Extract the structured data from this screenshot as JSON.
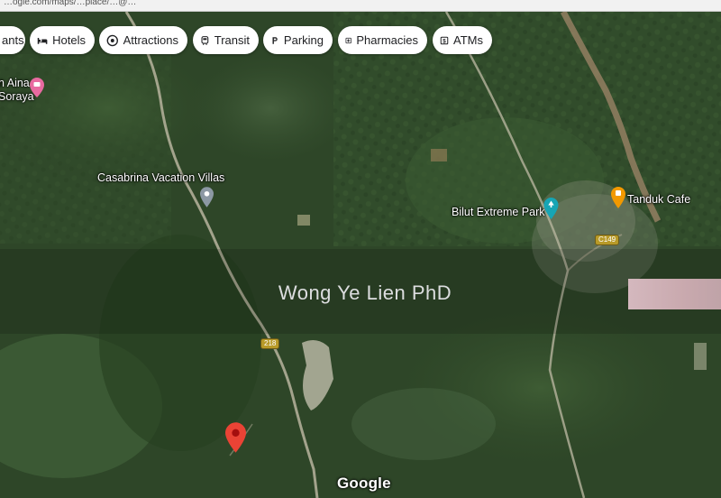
{
  "browser": {
    "url_fragment": "…ogle.com/maps/…place/…@…"
  },
  "chips": [
    {
      "label": "ants",
      "icon": "restaurant-icon"
    },
    {
      "label": "Hotels",
      "icon": "bed-icon"
    },
    {
      "label": "Attractions",
      "icon": "camera-icon"
    },
    {
      "label": "Transit",
      "icon": "train-icon"
    },
    {
      "label": "Parking",
      "icon": "parking-icon"
    },
    {
      "label": "Pharmacies",
      "icon": "pharmacy-icon"
    },
    {
      "label": "ATMs",
      "icon": "atm-icon"
    }
  ],
  "places": {
    "aina_line1": "n Aina",
    "aina_line2": "Soraya",
    "casabrina": "Casabrina Vacation Villas",
    "bilut": "Bilut Extreme Park",
    "tanduk": "Tanduk Cafe"
  },
  "roads": {
    "c149": "C149",
    "r218": "218"
  },
  "watermark": "Wong Ye Lien PhD",
  "branding": "Google",
  "colors": {
    "pin_red": "#ea4335",
    "pin_pink": "#e86aa0",
    "pin_grey": "#8c98a4",
    "pin_teal": "#16a5b5",
    "pin_orange": "#f29900",
    "forest": "#2f4a28",
    "road": "#b7b49e"
  }
}
